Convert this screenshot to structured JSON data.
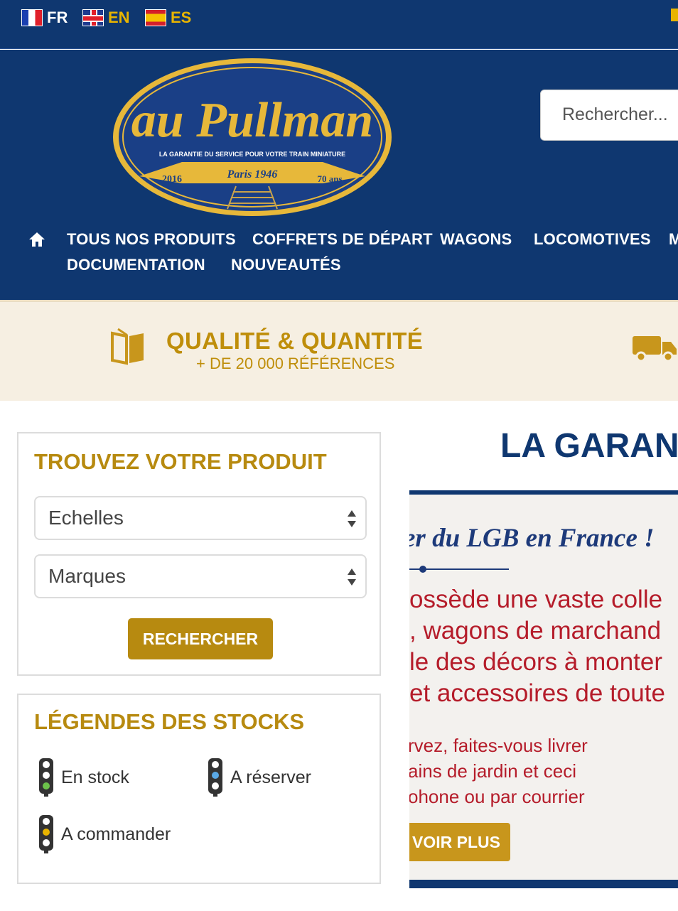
{
  "languages": [
    {
      "code": "FR",
      "active": true
    },
    {
      "code": "EN",
      "active": false
    },
    {
      "code": "ES",
      "active": false
    }
  ],
  "logo": {
    "brand": "au Pullman",
    "tagline": "LA GARANTIE DU SERVICE POUR VOTRE TRAIN MINIATURE",
    "since": "Paris 1946",
    "year": "2016",
    "anniversary": "70 ans"
  },
  "search": {
    "placeholder": "Rechercher..."
  },
  "nav": {
    "items": [
      "TOUS NOS PRODUITS",
      "COFFRETS DE DÉPART",
      "WAGONS",
      "LOCOMOTIVES",
      "M",
      "DOCUMENTATION",
      "NOUVEAUTÉS"
    ]
  },
  "strip": {
    "title": "QUALITÉ & QUANTITÉ",
    "subtitle": "+ DE 20 000 RÉFÉRENCES"
  },
  "finder": {
    "title": "TROUVEZ VOTRE PRODUIT",
    "scale_select": "Echelles",
    "brand_select": "Marques",
    "button": "RECHERCHER"
  },
  "legend": {
    "title": "LÉGENDES DES STOCKS",
    "items": [
      {
        "label": "En stock",
        "color": "#6cc24a"
      },
      {
        "label": "A réserver",
        "color": "#5aa9e6"
      },
      {
        "label": "A commander",
        "color": "#e8b400"
      }
    ]
  },
  "main": {
    "title": "LA GARANT"
  },
  "promo": {
    "heading": "er du LGB en France !",
    "lines": [
      "ossède une vaste colle",
      ", wagons de marchand",
      "le des décors à monter",
      "et accessoires de toute"
    ],
    "small_lines": [
      "rvez, faites-vous livrer",
      "ains de jardin et ceci",
      "ohone ou par courrier"
    ],
    "button": "VOIR PLUS"
  },
  "colors": {
    "navy": "#0f3770",
    "gold": "#b78a10",
    "cream": "#f6efe2",
    "promo_red": "#b51c2a"
  }
}
